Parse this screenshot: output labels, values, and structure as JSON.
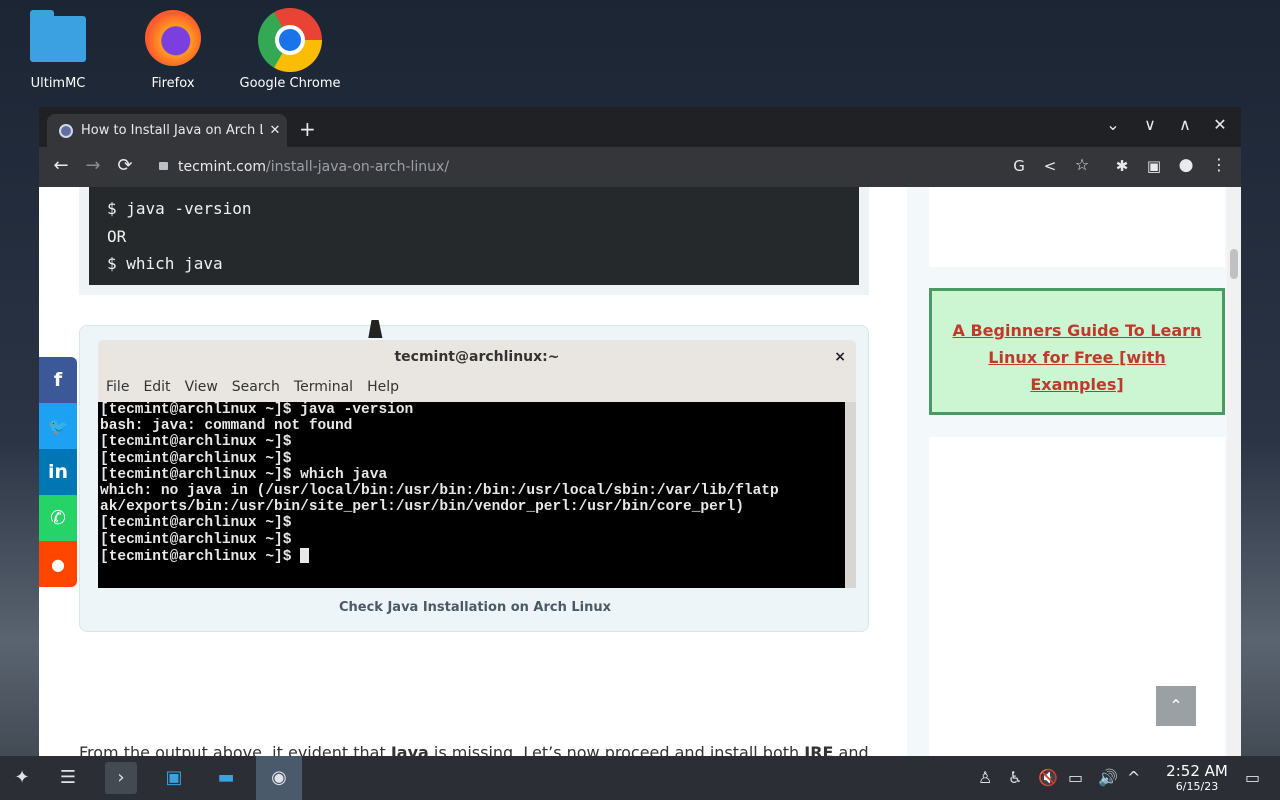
{
  "desktop": {
    "icons": [
      {
        "label": "UltimMC",
        "icon": "folder-icon"
      },
      {
        "label": "Firefox",
        "icon": "firefox-icon"
      },
      {
        "label": "Google Chrome",
        "icon": "chrome-icon"
      }
    ]
  },
  "browser": {
    "tab_title": "How to Install Java on Arch Li",
    "tab_close": "✕",
    "new_tab": "+",
    "url_host": "tecmint.com",
    "url_path": "/install-java-on-arch-linux/",
    "window_controls": [
      "⌄",
      "∨",
      "∧",
      "✕"
    ]
  },
  "article": {
    "code_lines": [
      "$ java -version",
      "OR",
      "$ which java"
    ],
    "terminal": {
      "title": "tecmint@archlinux:~",
      "close": "×",
      "menu": [
        "File",
        "Edit",
        "View",
        "Search",
        "Terminal",
        "Help"
      ],
      "lines": [
        "[tecmint@archlinux ~]$ java -version",
        "bash: java: command not found",
        "[tecmint@archlinux ~]$",
        "[tecmint@archlinux ~]$",
        "[tecmint@archlinux ~]$ which java",
        "which: no java in (/usr/local/bin:/usr/bin:/bin:/usr/local/sbin:/var/lib/flatp",
        "ak/exports/bin:/usr/bin/site_perl:/usr/bin/vendor_perl:/usr/bin/core_perl)",
        "[tecmint@archlinux ~]$",
        "[tecmint@archlinux ~]$",
        "[tecmint@archlinux ~]$ "
      ]
    },
    "caption": "Check Java Installation on Arch Linux",
    "paragraph_start": "From the output above, it evident that ",
    "paragraph_bold1": "Java",
    "paragraph_mid": " is missing. Let’s now proceed and install both ",
    "paragraph_bold2": "JRE",
    "paragraph_end": " and"
  },
  "sidebar": {
    "ad_line1": "A Beginners Guide To Learn",
    "ad_line2": "Linux for Free [with",
    "ad_line3": "Examples]"
  },
  "share": {
    "facebook": "f",
    "twitter": "🐦",
    "linkedin": "in",
    "whatsapp": "✆",
    "reddit": "●",
    "colors": {
      "facebook": "#3b5998",
      "twitter": "#1da1f2",
      "linkedin": "#0077b5",
      "whatsapp": "#25d366",
      "reddit": "#ff4500"
    }
  },
  "back_to_top": "⌃",
  "taskbar": {
    "time": "2:52 AM",
    "date": "6/15/23"
  }
}
